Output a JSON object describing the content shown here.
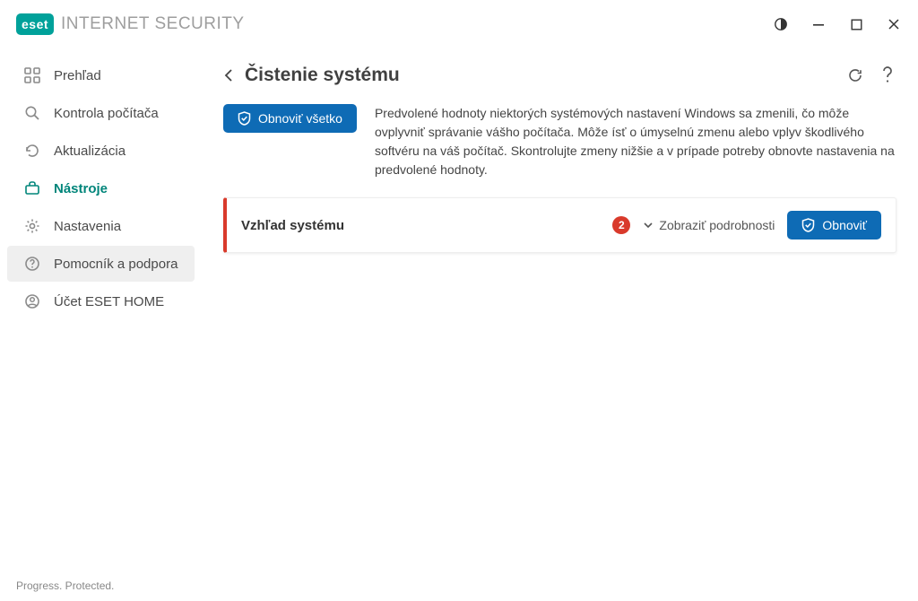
{
  "header": {
    "logo_badge": "eset",
    "logo_text": "INTERNET SECURITY"
  },
  "sidebar": {
    "items": [
      {
        "label": "Prehľad"
      },
      {
        "label": "Kontrola počítača"
      },
      {
        "label": "Aktualizácia"
      },
      {
        "label": "Nástroje"
      },
      {
        "label": "Nastavenia"
      },
      {
        "label": "Pomocník a podpora"
      },
      {
        "label": "Účet ESET HOME"
      }
    ]
  },
  "page": {
    "title": "Čistenie systému"
  },
  "actions": {
    "restore_all": "Obnoviť všetko",
    "info_text": "Predvolené hodnoty niektorých systémových nastavení Windows sa zmenili, čo môže ovplyvniť správanie vášho počítača. Môže ísť o úmyselnú zmenu alebo vplyv škodlivého softvéru na váš počítač. Skontrolujte zmeny nižšie a v prípade potreby obnovte nastavenia na predvolené hodnoty."
  },
  "card": {
    "title": "Vzhľad systému",
    "badge": "2",
    "details_link": "Zobraziť podrobnosti",
    "restore_button": "Obnoviť"
  },
  "footer": {
    "tagline": "Progress. Protected."
  }
}
